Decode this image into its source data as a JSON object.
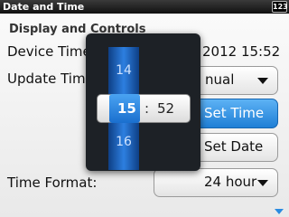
{
  "title_bar": {
    "title": "Date and Time",
    "indicator": "123"
  },
  "section_header": "Display and Controls",
  "device_time": {
    "label": "Device Time",
    "value_visible": "2012 15:52"
  },
  "update_time": {
    "label": "Update Time",
    "selected_visible": "nual"
  },
  "buttons": {
    "set_time": "Set Time",
    "set_date": "Set Date"
  },
  "time_format": {
    "label": "Time Format:",
    "selected": "24 hour"
  },
  "time_picker": {
    "hour_above": "14",
    "hour_selected": "15",
    "separator": ":",
    "minute_selected": "52",
    "hour_below": "16"
  },
  "colors": {
    "accent": "#2a8be0",
    "picker_bg": "#1d2126"
  }
}
